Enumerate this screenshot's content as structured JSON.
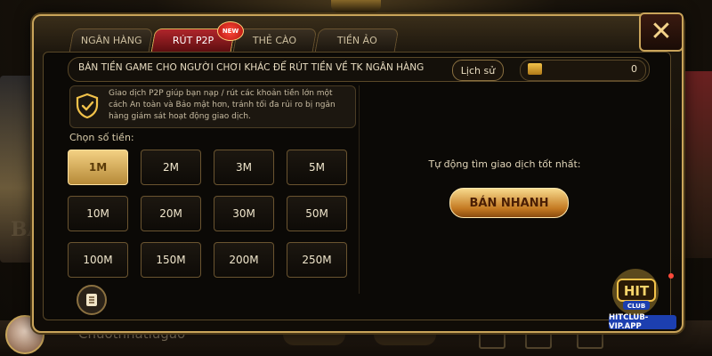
{
  "tabs": [
    {
      "label": "NGÂN HÀNG",
      "active": false
    },
    {
      "label": "RÚT P2P",
      "active": true
    },
    {
      "label": "THẺ CÀO",
      "active": false
    },
    {
      "label": "TIỀN ẢO",
      "active": false
    }
  ],
  "new_badge": "NEW",
  "header": {
    "title": "BÁN TIỀN GAME CHO NGƯỜI CHƠI KHÁC ĐỂ RÚT TIỀN VỀ TK NGÂN HÀNG",
    "history_label": "Lịch sử",
    "balance": "0"
  },
  "info": {
    "text": "Giao dịch P2P giúp bạn nạp / rút các khoản tiền lớn một cách An toàn và Bảo mật hơn, tránh tối đa rủi ro bị ngân hàng giám sát hoạt động giao dịch."
  },
  "amount": {
    "label": "Chọn số tiền:",
    "options": [
      "1M",
      "2M",
      "3M",
      "5M",
      "10M",
      "20M",
      "30M",
      "50M",
      "100M",
      "150M",
      "200M",
      "250M"
    ],
    "selected": "1M"
  },
  "right": {
    "best_text": "Tự động tìm giao dịch tốt nhất:",
    "sell_label": "BÁN NHANH"
  },
  "background": {
    "username": "Chuotnhatlugao",
    "left_text": "BA"
  },
  "watermark": {
    "logo_text": "HIT",
    "club_text": "CLUB",
    "url": "HITCLUB-VIP.APP"
  },
  "colors": {
    "gold": "#c9a45a",
    "selected_amount": "#f3d083",
    "active_tab": "#b0252b"
  }
}
